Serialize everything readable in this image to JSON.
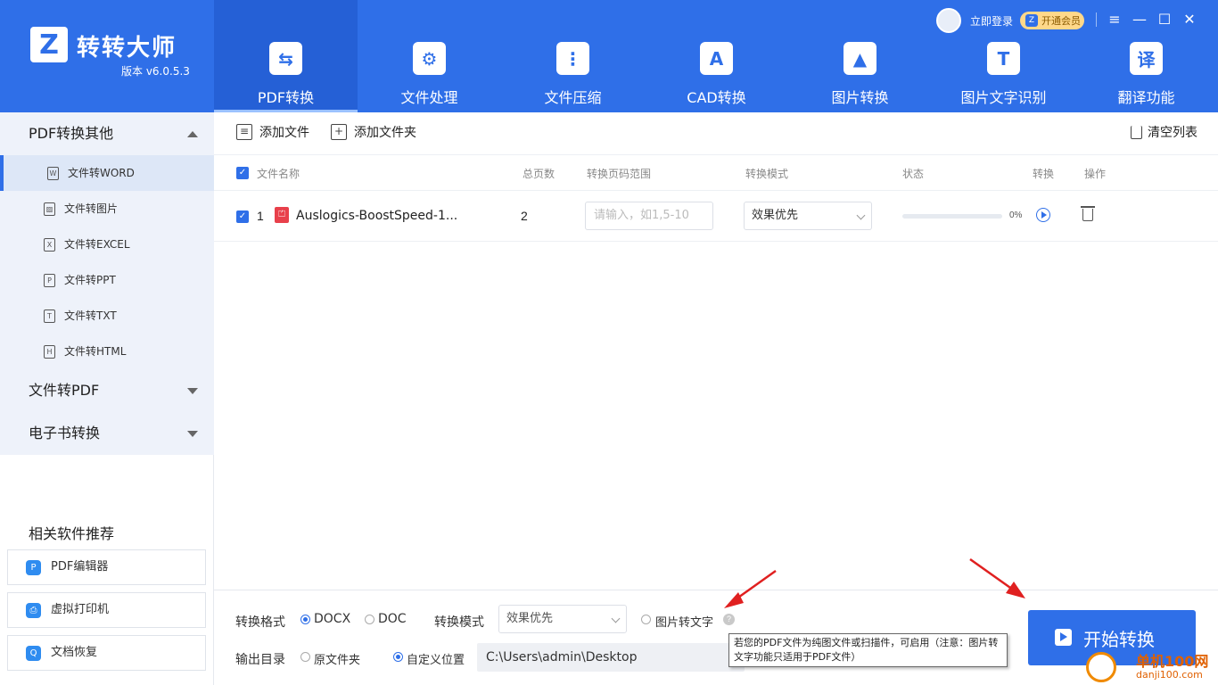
{
  "app": {
    "name": "转转大师",
    "version": "版本 v6.0.5.3",
    "logo_letter": "Z"
  },
  "topbar": {
    "login": "立即登录",
    "vip": "开通会员",
    "vip_badge": "Z"
  },
  "window_controls": [
    "≡",
    "—",
    "☐",
    "✕"
  ],
  "nav_tabs": [
    {
      "label": "PDF转换",
      "icon": "pdf-convert-icon",
      "glyph": "⇆",
      "active": true
    },
    {
      "label": "文件处理",
      "icon": "file-process-icon",
      "glyph": "⚙"
    },
    {
      "label": "文件压缩",
      "icon": "file-compress-icon",
      "glyph": "⋮"
    },
    {
      "label": "CAD转换",
      "icon": "cad-icon",
      "glyph": "A"
    },
    {
      "label": "图片转换",
      "icon": "image-convert-icon",
      "glyph": "▲"
    },
    {
      "label": "图片文字识别",
      "icon": "ocr-icon",
      "glyph": "T"
    },
    {
      "label": "翻译功能",
      "icon": "translate-icon",
      "glyph": "译"
    }
  ],
  "sidebar": {
    "sections": [
      {
        "label": "PDF转换其他",
        "expanded": true
      },
      {
        "label": "文件转PDF",
        "expanded": false
      },
      {
        "label": "电子书转换",
        "expanded": false
      }
    ],
    "items": [
      {
        "label": "文件转WORD",
        "glyph": "W",
        "active": true
      },
      {
        "label": "文件转图片",
        "glyph": "▨"
      },
      {
        "label": "文件转EXCEL",
        "glyph": "X"
      },
      {
        "label": "文件转PPT",
        "glyph": "P"
      },
      {
        "label": "文件转TXT",
        "glyph": "T"
      },
      {
        "label": "文件转HTML",
        "glyph": "H"
      }
    ],
    "reco_title": "相关软件推荐",
    "reco": [
      {
        "label": "PDF编辑器",
        "glyph": "P"
      },
      {
        "label": "虚拟打印机",
        "glyph": "⎙"
      },
      {
        "label": "文档恢复",
        "glyph": "Q"
      }
    ]
  },
  "toolbar": {
    "add_file": "添加文件",
    "add_folder": "添加文件夹",
    "clear": "清空列表"
  },
  "table": {
    "headers": [
      "文件名称",
      "总页数",
      "转换页码范围",
      "转换模式",
      "状态",
      "转换",
      "操作"
    ],
    "rows": [
      {
        "index": "1",
        "name": "Auslogics-BoostSpeed-1...",
        "pages": "2",
        "range_placeholder": "请输入，如1,5-10",
        "mode": "效果优先",
        "progress": "0%",
        "progress_value": 0
      }
    ]
  },
  "bottom": {
    "format_label": "转换格式",
    "formats": [
      {
        "label": "DOCX",
        "selected": true
      },
      {
        "label": "DOC",
        "selected": false
      }
    ],
    "mode_label": "转换模式",
    "mode_value": "效果优先",
    "ocr_label": "图片转文字",
    "help": "?",
    "output_label": "输出目录",
    "outputs": [
      {
        "label": "原文件夹",
        "selected": false
      },
      {
        "label": "自定义位置",
        "selected": true
      }
    ],
    "path": "C:\\Users\\admin\\Desktop",
    "tooltip": "若您的PDF文件为纯图文件或扫描件，可启用（注意：图片转文字功能只适用于PDF文件）",
    "start": "开始转换"
  },
  "watermark": {
    "title": "单机100网",
    "url": "danji100.com"
  },
  "colors": {
    "brand": "#2f6fe8",
    "annotation_arrow": "#e02020"
  }
}
